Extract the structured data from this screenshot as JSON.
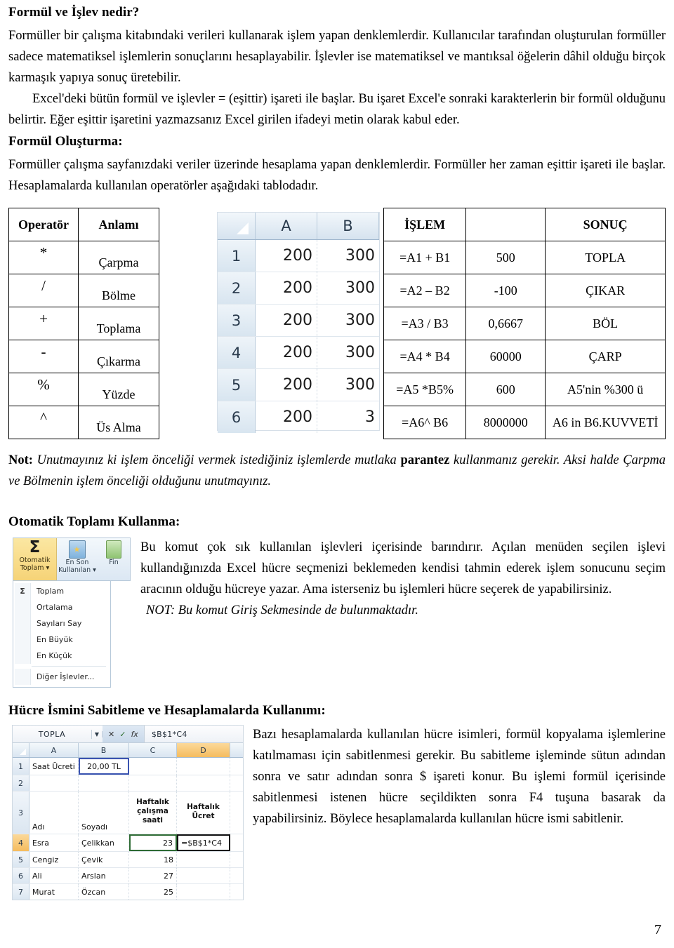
{
  "document": {
    "page_number": "7"
  },
  "section1": {
    "heading": "Formül ve İşlev nedir?",
    "p1": "Formüller bir çalışma kitabındaki verileri kullanarak işlem yapan denklemlerdir. Kullanıcılar tarafından oluşturulan formüller sadece matematiksel işlemlerin sonuçlarını hesaplayabilir. İşlevler ise matematiksel ve mantıksal öğelerin dâhil olduğu birçok karmaşık yapıya sonuç üretebilir.",
    "p2": "Excel'deki bütün formül ve işlevler = (eşittir) işareti ile başlar. Bu işaret Excel'e sonraki karakterlerin bir formül olduğunu belirtir. Eğer eşittir işaretini yazmazsanız Excel girilen ifadeyi metin olarak kabul eder.",
    "heading2": "Formül Oluşturma:",
    "p3": "Formüller çalışma sayfanızdaki veriler üzerinde hesaplama yapan denklemlerdir. Formüller her zaman eşittir işareti ile başlar. Hesaplamalarda kullanılan operatörler aşağıdaki tablodadır."
  },
  "operator_table": {
    "headers": [
      "Operatör",
      "Anlamı"
    ],
    "rows": [
      {
        "symbol": "*",
        "meaning": "Çarpma"
      },
      {
        "symbol": "/",
        "meaning": "Bölme"
      },
      {
        "symbol": "+",
        "meaning": "Toplama"
      },
      {
        "symbol": "-",
        "meaning": "Çıkarma"
      },
      {
        "symbol": "%",
        "meaning": "Yüzde"
      },
      {
        "symbol": "^",
        "meaning": "Üs Alma"
      }
    ]
  },
  "excel_mini": {
    "columns": [
      "A",
      "B"
    ],
    "rows": [
      {
        "num": "1",
        "a": "200",
        "b": "300"
      },
      {
        "num": "2",
        "a": "200",
        "b": "300"
      },
      {
        "num": "3",
        "a": "200",
        "b": "300"
      },
      {
        "num": "4",
        "a": "200",
        "b": "300"
      },
      {
        "num": "5",
        "a": "200",
        "b": "300"
      },
      {
        "num": "6",
        "a": "200",
        "b": "3"
      }
    ]
  },
  "islem_table": {
    "headers": [
      "İŞLEM",
      "",
      "SONUÇ"
    ],
    "rows": [
      {
        "islem": "=A1 + B1",
        "deger": "500",
        "sonuc": "TOPLA"
      },
      {
        "islem": "=A2 – B2",
        "deger": "-100",
        "sonuc": "ÇIKAR"
      },
      {
        "islem": "=A3 / B3",
        "deger": "0,6667",
        "sonuc": "BÖL"
      },
      {
        "islem": "=A4 * B4",
        "deger": "60000",
        "sonuc": "ÇARP"
      },
      {
        "islem": "=A5 *B5%",
        "deger": "600",
        "sonuc": "A5'nin %300 ü"
      },
      {
        "islem": "=A6^ B6",
        "deger": "8000000",
        "sonuc": "A6 in B6.KUVVETİ"
      }
    ]
  },
  "note": {
    "lead": "Not:",
    "text_part1": " Unutmayınız ki işlem önceliği vermek istediğiniz işlemlerde mutlaka ",
    "bold_word": "parantez",
    "text_part2": " kullanmanız gerekir. Aksi halde Çarpma ve Bölmenin işlem önceliği olduğunu unutmayınız."
  },
  "autosum": {
    "heading": "Otomatik Toplamı Kullanma:",
    "ribbon": {
      "button1_line1": "Otomatik",
      "button1_line2": "Toplam",
      "button2_line1": "En Son",
      "button2_line2": "Kullanılan",
      "button3_line1": "Fin",
      "sigma": "Σ"
    },
    "menu_items": [
      "Toplam",
      "Ortalama",
      "Sayıları Say",
      "En Büyük",
      "En Küçük",
      "Diğer İşlevler..."
    ],
    "menu_marker": "Σ",
    "paragraph": "Bu komut çok sık kullanılan işlevleri içerisinde barındırır. Açılan menüden seçilen işlevi kullandığınızda Excel hücre seçmenizi beklemeden kendisi tahmin ederek işlem sonucunu seçim aracının olduğu hücreye yazar. Ama isterseniz bu işlemleri hücre seçerek de yapabilirsiniz.",
    "note_italic": "NOT: Bu komut Giriş Sekmesinde de bulunmaktadır."
  },
  "cellref": {
    "heading": "Hücre İsmini Sabitleme ve Hesaplamalarda Kullanımı:",
    "paragraph": "Bazı hesaplamalarda kullanılan hücre isimleri, formül kopyalama işlemlerine katılmaması için sabitlenmesi gerekir. Bu sabitleme işleminde sütun adından sonra ve satır adından sonra $ işareti konur. Bu işlemi formül içerisinde sabitlenmesi istenen hücre seçildikten sonra F4 tuşuna basarak da yapabilirsiniz. Böylece hesaplamalarda kullanılan hücre ismi sabitlenir.",
    "excel": {
      "name_box": "TOPLA",
      "formula_bar": "$B$1*C4",
      "icon_cancel": "✕",
      "icon_confirm": "✓",
      "icon_function": "fx",
      "columns": [
        "A",
        "B",
        "C",
        "D",
        ""
      ],
      "rows": [
        {
          "num": "1",
          "a": "Saat Ücreti",
          "b": "20,00 TL",
          "c": "",
          "d": ""
        },
        {
          "num": "2",
          "a": "",
          "b": "",
          "c": "",
          "d": ""
        },
        {
          "num": "3",
          "a": "Adı",
          "b": "Soyadı",
          "c": "Haftalık çalışma saati",
          "d": "Haftalık Ücret"
        },
        {
          "num": "4",
          "a": "Esra",
          "b": "Çelikkan",
          "c": "23",
          "d": "=$B$1*C4"
        },
        {
          "num": "5",
          "a": "Cengiz",
          "b": "Çevik",
          "c": "18",
          "d": ""
        },
        {
          "num": "6",
          "a": "Ali",
          "b": "Arslan",
          "c": "27",
          "d": ""
        },
        {
          "num": "7",
          "a": "Murat",
          "b": "Özcan",
          "c": "25",
          "d": ""
        }
      ]
    }
  },
  "colors": {
    "selection_orange": "#f5bc5e",
    "excel_header_blue": "#d6e3ef",
    "autosum_yellow": "#f6d377"
  }
}
